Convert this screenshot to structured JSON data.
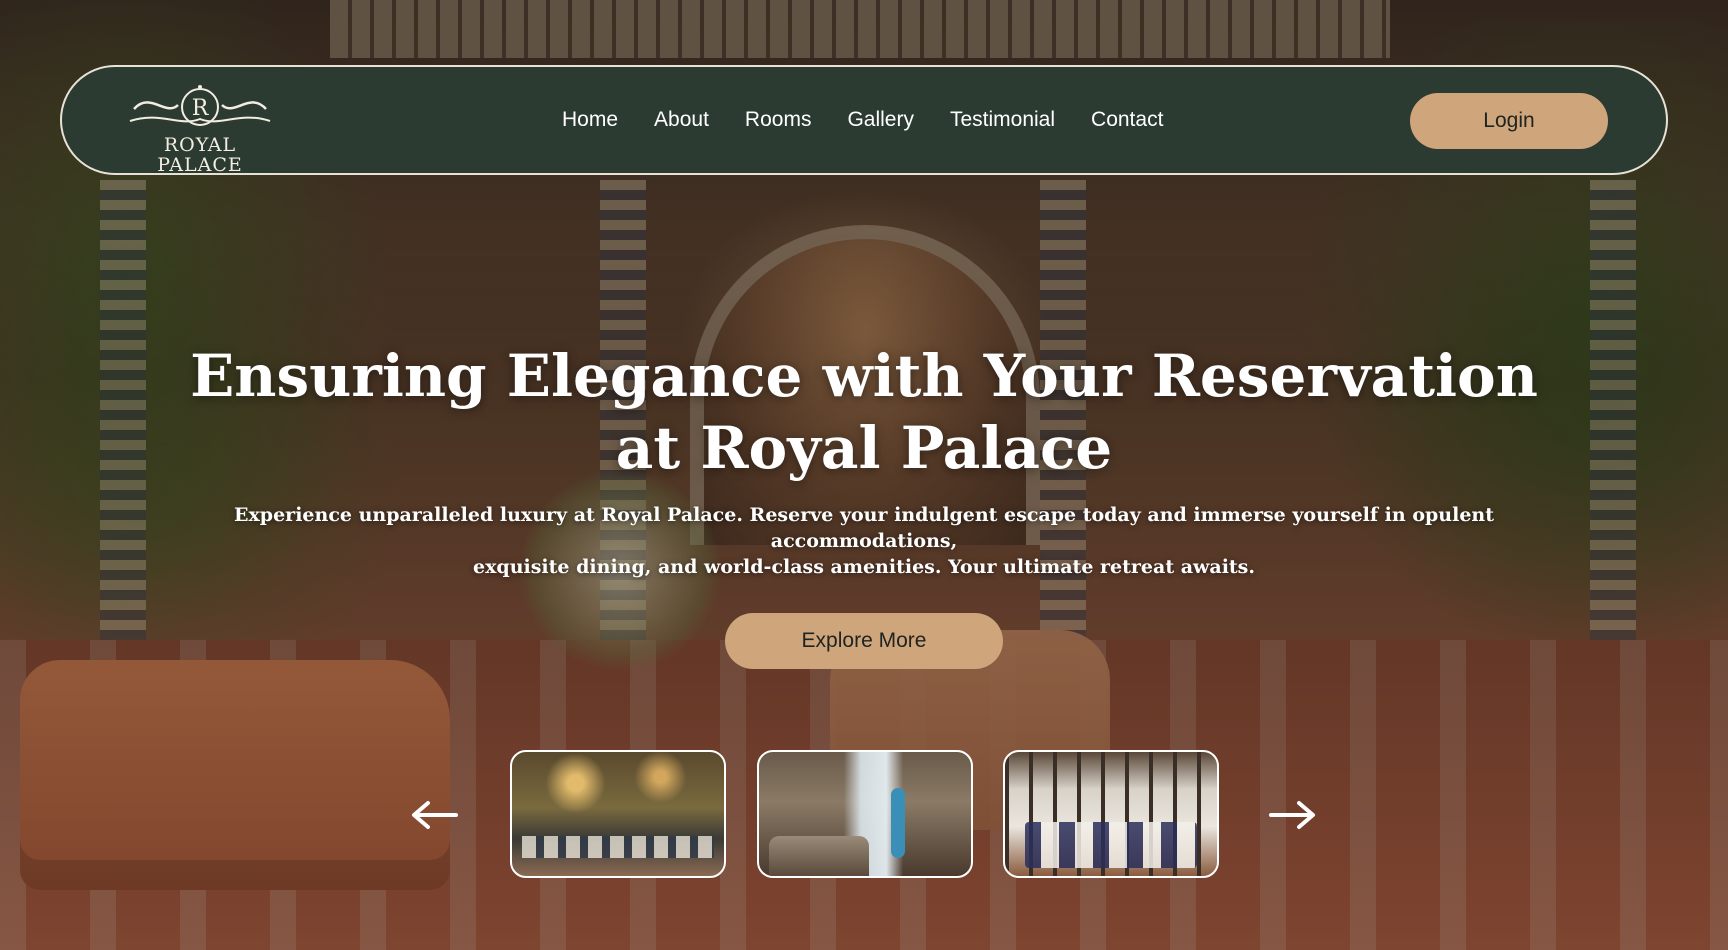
{
  "brand": {
    "logo_letter": "R",
    "logo_text": "ROYAL PALACE"
  },
  "nav": {
    "items": [
      {
        "label": "Home"
      },
      {
        "label": "About"
      },
      {
        "label": "Rooms"
      },
      {
        "label": "Gallery"
      },
      {
        "label": "Testimonial"
      },
      {
        "label": "Contact"
      }
    ],
    "login_label": "Login"
  },
  "hero": {
    "title_line1": "Ensuring Elegance with Your Reservation",
    "title_line2": "at Royal Palace",
    "subtitle_line1": "Experience unparalleled luxury at Royal Palace. Reserve your indulgent escape today and immerse yourself in opulent accommodations,",
    "subtitle_line2": "exquisite dining, and world-class amenities. Your ultimate retreat awaits.",
    "cta_label": "Explore More"
  },
  "carousel": {
    "prev_icon": "arrow-left-icon",
    "next_icon": "arrow-right-icon",
    "thumbnails": [
      {
        "icon": "restaurant-interior-image"
      },
      {
        "icon": "bedroom-balcony-image"
      },
      {
        "icon": "dining-hall-image"
      }
    ]
  },
  "colors": {
    "navbar_bg": "#2b3b31",
    "accent": "#cfa57c",
    "button_text": "#1f2420",
    "text_light": "#ffffff"
  }
}
